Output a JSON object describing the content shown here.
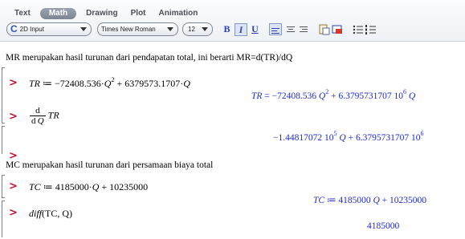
{
  "toolbar": {
    "tabs": [
      "Text",
      "Math",
      "Drawing",
      "Plot",
      "Animation"
    ],
    "active_tab": "Math",
    "input_mode": "2D Input",
    "font": "Times New Roman",
    "font_size": "12",
    "bold": "B",
    "italic": "I",
    "underline": "U"
  },
  "worksheet": {
    "text1": "MR merupakan hasil turunan dari pendapatan total, ini berarti MR=d(TR)/dQ",
    "input1": {
      "lhs": "TR",
      "assign": "≔",
      "c1": "−72408.536",
      "var": "Q",
      "pow": "2",
      "plus": "+",
      "c2": "6379573.1707"
    },
    "output1": {
      "lhs": "TR",
      "eq": "=",
      "c1": "−72408.536",
      "var": "Q",
      "pow": "2",
      "plus": "+",
      "mant": "6.3795731707",
      "base": "10",
      "exp": "6"
    },
    "input2": {
      "d": "d",
      "dq": "d",
      "var": "Q",
      "fn": "TR"
    },
    "output2": {
      "mant1": "−1.44817072",
      "base": "10",
      "exp1": "5",
      "var": "Q",
      "plus": "+",
      "mant2": "6.3795731707",
      "exp2": "6"
    },
    "text2": "MC merupakan hasil turunan dari persamaan biaya total",
    "input3": {
      "lhs": "TC",
      "assign": "≔",
      "c1": "4185000",
      "var": "Q",
      "plus": "+",
      "c2": "10235000"
    },
    "output3": {
      "lhs": "TC",
      "assign": "≔",
      "c1": "4185000",
      "var": "Q",
      "plus": "+",
      "c2": "10235000"
    },
    "input4": {
      "fn": "diff",
      "args": "(TC, Q)"
    },
    "output4": "4185000",
    "prompt": ">"
  },
  "colors": {
    "prompt": "#c8102e",
    "output": "#1f2bd0",
    "accent": "#2b3fb0"
  }
}
